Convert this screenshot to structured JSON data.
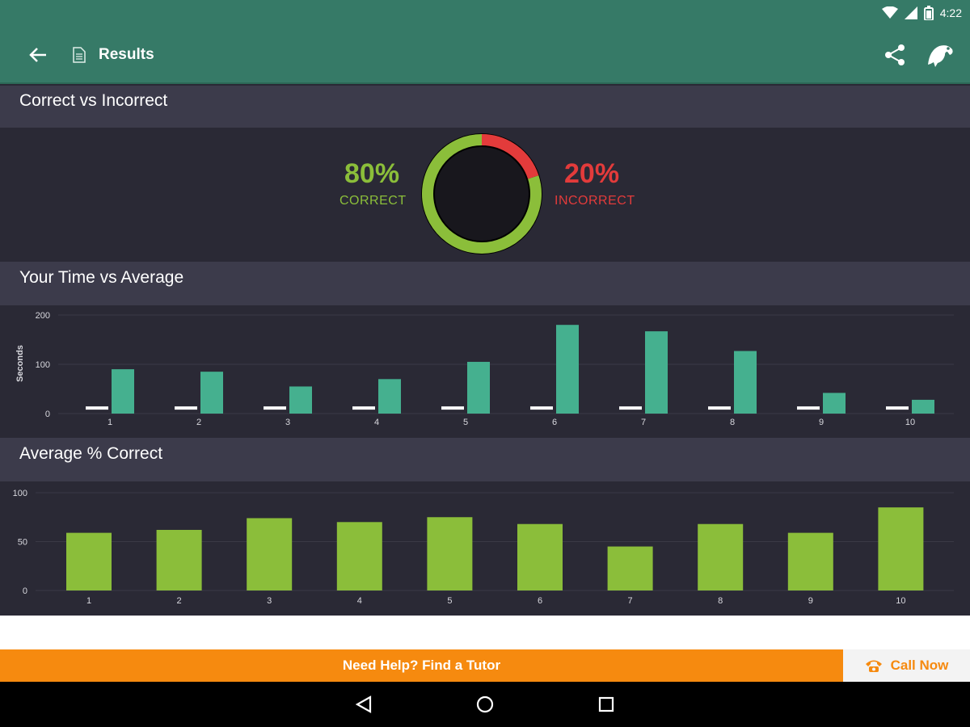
{
  "status_bar": {
    "time": "4:22"
  },
  "app_bar": {
    "title": "Results"
  },
  "sections": {
    "correct_vs_incorrect": {
      "title": "Correct vs Incorrect",
      "correct_pct": "80%",
      "correct_label": "CORRECT",
      "incorrect_pct": "20%",
      "incorrect_label": "INCORRECT"
    },
    "time_vs_average": {
      "title": "Your Time vs Average"
    },
    "average_correct": {
      "title": "Average % Correct"
    }
  },
  "banner": {
    "text": "Need Help? Find a Tutor",
    "call_label": "Call Now"
  },
  "colors": {
    "header_green": "#367a67",
    "correct_green": "#8bbe3a",
    "incorrect_red": "#e33b3b",
    "teal_bar": "#45b08f",
    "orange": "#f68a0f"
  },
  "icons": [
    "wifi-icon",
    "signal-icon",
    "battery-icon",
    "back-arrow-icon",
    "document-icon",
    "share-icon",
    "chameleon-logo-icon",
    "phone-icon",
    "nav-back-icon",
    "nav-home-icon",
    "nav-recents-icon"
  ],
  "chart_data": [
    {
      "type": "pie",
      "labels": [
        "CORRECT",
        "INCORRECT"
      ],
      "values": [
        80,
        20
      ]
    },
    {
      "type": "bar",
      "title": "Your Time vs Average",
      "ylabel": "Seconds",
      "ylim": [
        0,
        200
      ],
      "yticks": [
        "0",
        "100",
        "200"
      ],
      "categories": [
        "1",
        "2",
        "3",
        "4",
        "5",
        "6",
        "7",
        "8",
        "9",
        "10"
      ],
      "series": [
        {
          "values": [
            8,
            8,
            8,
            8,
            8,
            8,
            8,
            8,
            8,
            8
          ]
        },
        {
          "values": [
            90,
            85,
            55,
            70,
            105,
            180,
            167,
            127,
            42,
            28
          ]
        }
      ]
    },
    {
      "type": "bar",
      "title": "Average % Correct",
      "ylim": [
        0,
        100
      ],
      "yticks": [
        "0",
        "50",
        "100"
      ],
      "categories": [
        "1",
        "2",
        "3",
        "4",
        "5",
        "6",
        "7",
        "8",
        "9",
        "10"
      ],
      "values": [
        59,
        62,
        74,
        70,
        75,
        68,
        45,
        68,
        59,
        85
      ]
    }
  ]
}
